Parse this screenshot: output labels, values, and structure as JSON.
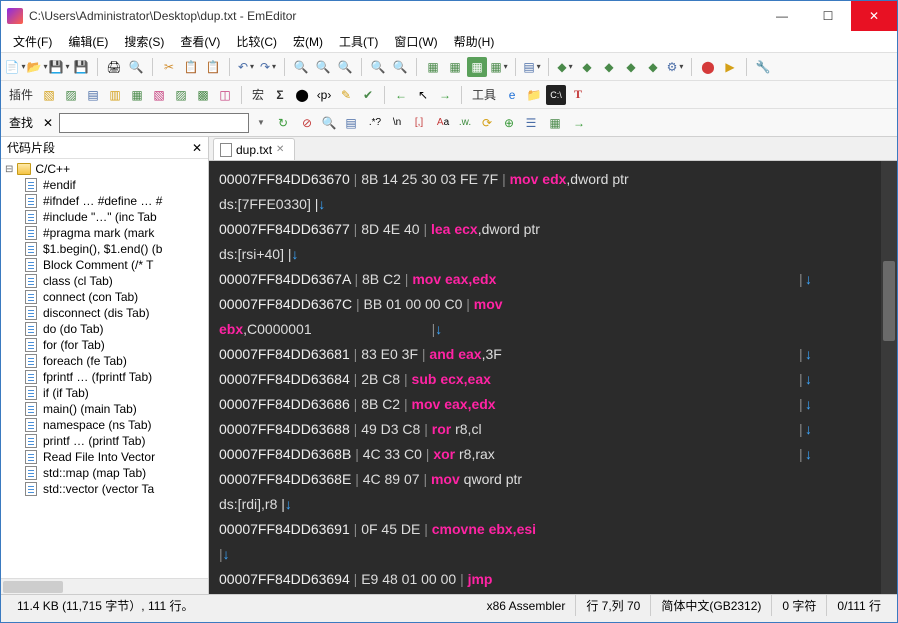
{
  "title": "C:\\Users\\Administrator\\Desktop\\dup.txt - EmEditor",
  "menu": [
    "文件(F)",
    "编辑(E)",
    "搜索(S)",
    "查看(V)",
    "比较(C)",
    "宏(M)",
    "工具(T)",
    "窗口(W)",
    "帮助(H)"
  ],
  "tb2": {
    "plugins_label": "插件",
    "macro_label": "宏",
    "tools_label": "工具"
  },
  "find": {
    "label": "查找",
    "placeholder": ""
  },
  "sidebar": {
    "title": "代码片段",
    "root": "C/C++",
    "items": [
      "#endif",
      "#ifndef … #define … #",
      "#include \"…\"  (inc Tab",
      "#pragma mark  (mark",
      "$1.begin(), $1.end()  (b",
      "Block Comment  (/* T",
      "class  (cl Tab)",
      "connect  (con Tab)",
      "disconnect  (dis Tab)",
      "do  (do Tab)",
      "for  (for Tab)",
      "foreach  (fe Tab)",
      "fprintf …  (fprintf Tab)",
      "if  (if Tab)",
      "main()  (main Tab)",
      "namespace  (ns Tab)",
      "printf …  (printf Tab)",
      "Read File Into Vector",
      "std::map  (map Tab)",
      "std::vector  (vector Ta"
    ]
  },
  "tab": {
    "name": "dup.txt"
  },
  "code_lines": [
    {
      "addr": "00007FF84DD63670",
      "bytes": "8B 14 25 30 03 FE 7F",
      "pipe2": "|",
      "mnem": "mov",
      "arg": "edx",
      "tail": ",dword ptr"
    },
    {
      "raw": "ds:[7FFE0330]     |",
      "arrow": true
    },
    {
      "addr": "00007FF84DD63677",
      "bytes": "8D 4E 40",
      "pipe2": "|",
      "mnem": "lea",
      "arg": "ecx",
      "tail": ",dword ptr"
    },
    {
      "raw": "ds:[rsi+40]        |",
      "arrow": true
    },
    {
      "addr": "00007FF84DD6367A",
      "bytes": "8B C2",
      "pipe2": "|",
      "mnem": "mov",
      "arg": "eax,edx",
      "far_pipe": true,
      "far_arrow": true
    },
    {
      "addr": "00007FF84DD6367C",
      "bytes": "BB 01 00 00 C0",
      "pipe2": "|",
      "mnem": "mov"
    },
    {
      "wrap": "ebx",
      "wrap_tail": ",C0000001",
      "wrap_pipe": true,
      "wrap_arrow": true
    },
    {
      "addr": "00007FF84DD63681",
      "bytes": "83 E0 3F",
      "pipe2": "|",
      "mnem": "and",
      "arg": "eax",
      "tail": ",3F",
      "far_pipe": true,
      "far_arrow": true
    },
    {
      "addr": "00007FF84DD63684",
      "bytes": "2B C8",
      "pipe2": "|",
      "mnem": "sub",
      "arg": "ecx,eax",
      "far_pipe": true,
      "far_arrow": true
    },
    {
      "addr": "00007FF84DD63686",
      "bytes": "8B C2",
      "pipe2": "|",
      "mnem": "mov",
      "arg": "eax,edx",
      "far_pipe": true,
      "far_arrow": true
    },
    {
      "addr": "00007FF84DD63688",
      "bytes": "49 D3 C8",
      "pipe2": " |",
      "mnem": "ror",
      "regtxt": " r8,cl",
      "far_pipe": true,
      "far_arrow": true
    },
    {
      "addr": "00007FF84DD6368B",
      "bytes": "4C 33 C0",
      "pipe2": " |",
      "mnem": "xor",
      "regtxt": " r8,rax",
      "far_pipe": true,
      "far_arrow": true
    },
    {
      "addr": "00007FF84DD6368E",
      "bytes": "4C 89 07",
      "pipe2": "|",
      "mnem": "mov",
      "tail": " qword ptr"
    },
    {
      "raw": "ds:[rdi],r8        |",
      "arrow": true
    },
    {
      "addr": "00007FF84DD63691",
      "bytes": "0F 45 DE",
      "pipe2": "|",
      "mnem": "cmovne",
      "arg": "ebx,esi"
    },
    {
      "only_pipe": true,
      "arrow": true
    },
    {
      "addr": "00007FF84DD63694",
      "bytes": "E9 48 01 00 00",
      "pipe2": " |",
      "mnem": "jmp"
    }
  ],
  "status": {
    "left": "11.4 KB (11,715 字节）, 111 行。",
    "mode": "x86 Assembler",
    "pos": "行 7,列 70",
    "enc": "简体中文(GB2312)",
    "sel": "0 字符",
    "lines": "0/111 行"
  }
}
